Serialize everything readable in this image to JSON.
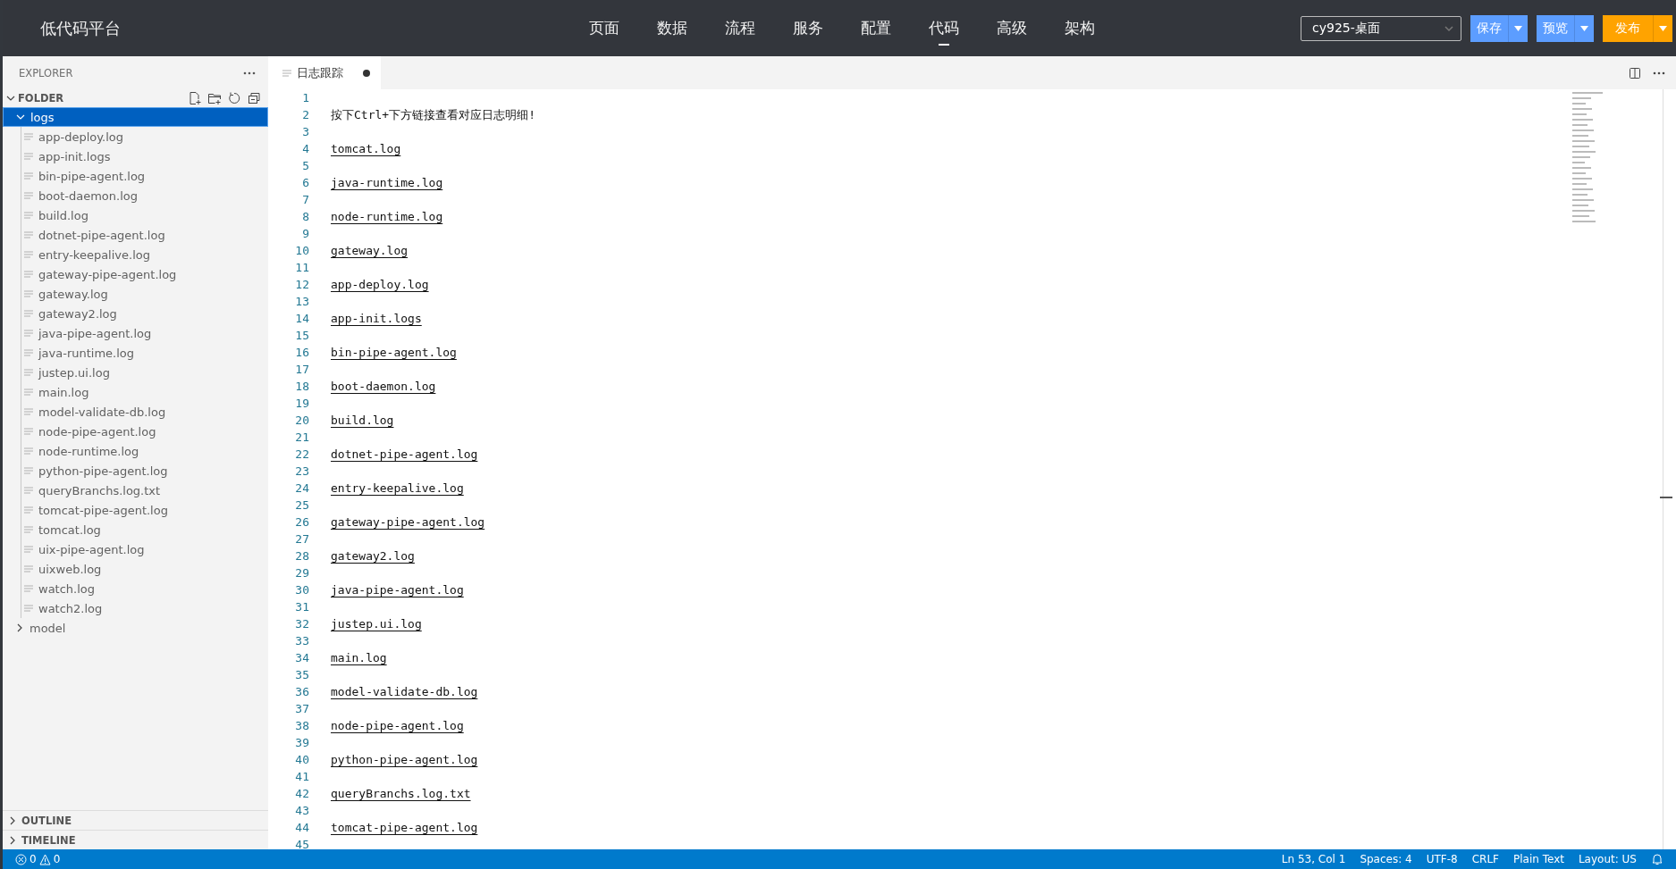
{
  "app": {
    "title": "低代码平台"
  },
  "nav": [
    {
      "label": "页面",
      "selected": false
    },
    {
      "label": "数据",
      "selected": false
    },
    {
      "label": "流程",
      "selected": false
    },
    {
      "label": "服务",
      "selected": false
    },
    {
      "label": "配置",
      "selected": false
    },
    {
      "label": "代码",
      "selected": true
    },
    {
      "label": "高级",
      "selected": false
    },
    {
      "label": "架构",
      "selected": false
    }
  ],
  "workspace_select": {
    "value": "cy925-桌面"
  },
  "actions": [
    {
      "label": "保存",
      "kind": "blue"
    },
    {
      "label": "预览",
      "kind": "blue"
    },
    {
      "label": "发布",
      "kind": "orange"
    }
  ],
  "sidebar": {
    "title": "EXPLORER",
    "section": "FOLDER",
    "tree": [
      {
        "label": "logs",
        "expanded": true,
        "selected": true,
        "children": [
          {
            "label": "app-deploy.log"
          },
          {
            "label": "app-init.logs"
          },
          {
            "label": "bin-pipe-agent.log"
          },
          {
            "label": "boot-daemon.log"
          },
          {
            "label": "build.log"
          },
          {
            "label": "dotnet-pipe-agent.log"
          },
          {
            "label": "entry-keepalive.log"
          },
          {
            "label": "gateway-pipe-agent.log"
          },
          {
            "label": "gateway.log"
          },
          {
            "label": "gateway2.log"
          },
          {
            "label": "java-pipe-agent.log"
          },
          {
            "label": "java-runtime.log"
          },
          {
            "label": "justep.ui.log"
          },
          {
            "label": "main.log"
          },
          {
            "label": "model-validate-db.log"
          },
          {
            "label": "node-pipe-agent.log"
          },
          {
            "label": "node-runtime.log"
          },
          {
            "label": "python-pipe-agent.log"
          },
          {
            "label": "queryBranchs.log.txt"
          },
          {
            "label": "tomcat-pipe-agent.log"
          },
          {
            "label": "tomcat.log"
          },
          {
            "label": "uix-pipe-agent.log"
          },
          {
            "label": "uixweb.log"
          },
          {
            "label": "watch.log"
          },
          {
            "label": "watch2.log"
          }
        ]
      },
      {
        "label": "model",
        "expanded": false,
        "selected": false
      }
    ],
    "panels": [
      {
        "label": "OUTLINE",
        "expanded": false
      },
      {
        "label": "TIMELINE",
        "expanded": false
      }
    ]
  },
  "tab": {
    "label": "日志跟踪",
    "dirty": true
  },
  "editor": {
    "lines": [
      {
        "number": "1",
        "kind": "blank"
      },
      {
        "number": "2",
        "kind": "text",
        "text": "按下Ctrl+下方链接查看对应日志明细!"
      },
      {
        "number": "3",
        "kind": "blank"
      },
      {
        "number": "4",
        "kind": "link",
        "text": "tomcat.log"
      },
      {
        "number": "5",
        "kind": "blank"
      },
      {
        "number": "6",
        "kind": "link",
        "text": "java-runtime.log"
      },
      {
        "number": "7",
        "kind": "blank"
      },
      {
        "number": "8",
        "kind": "link",
        "text": "node-runtime.log"
      },
      {
        "number": "9",
        "kind": "blank"
      },
      {
        "number": "10",
        "kind": "link",
        "text": "gateway.log"
      },
      {
        "number": "11",
        "kind": "blank"
      },
      {
        "number": "12",
        "kind": "link",
        "text": "app-deploy.log"
      },
      {
        "number": "13",
        "kind": "blank"
      },
      {
        "number": "14",
        "kind": "link",
        "text": "app-init.logs"
      },
      {
        "number": "15",
        "kind": "blank"
      },
      {
        "number": "16",
        "kind": "link",
        "text": "bin-pipe-agent.log"
      },
      {
        "number": "17",
        "kind": "blank"
      },
      {
        "number": "18",
        "kind": "link",
        "text": "boot-daemon.log"
      },
      {
        "number": "19",
        "kind": "blank"
      },
      {
        "number": "20",
        "kind": "link",
        "text": "build.log"
      },
      {
        "number": "21",
        "kind": "blank"
      },
      {
        "number": "22",
        "kind": "link",
        "text": "dotnet-pipe-agent.log"
      },
      {
        "number": "23",
        "kind": "blank"
      },
      {
        "number": "24",
        "kind": "link",
        "text": "entry-keepalive.log"
      },
      {
        "number": "25",
        "kind": "blank"
      },
      {
        "number": "26",
        "kind": "link",
        "text": "gateway-pipe-agent.log"
      },
      {
        "number": "27",
        "kind": "blank"
      },
      {
        "number": "28",
        "kind": "link",
        "text": "gateway2.log"
      },
      {
        "number": "29",
        "kind": "blank"
      },
      {
        "number": "30",
        "kind": "link",
        "text": "java-pipe-agent.log"
      },
      {
        "number": "31",
        "kind": "blank"
      },
      {
        "number": "32",
        "kind": "link",
        "text": "justep.ui.log"
      },
      {
        "number": "33",
        "kind": "blank"
      },
      {
        "number": "34",
        "kind": "link",
        "text": "main.log"
      },
      {
        "number": "35",
        "kind": "blank"
      },
      {
        "number": "36",
        "kind": "link",
        "text": "model-validate-db.log"
      },
      {
        "number": "37",
        "kind": "blank"
      },
      {
        "number": "38",
        "kind": "link",
        "text": "node-pipe-agent.log"
      },
      {
        "number": "39",
        "kind": "blank"
      },
      {
        "number": "40",
        "kind": "link",
        "text": "python-pipe-agent.log"
      },
      {
        "number": "41",
        "kind": "blank"
      },
      {
        "number": "42",
        "kind": "link",
        "text": "queryBranchs.log.txt"
      },
      {
        "number": "43",
        "kind": "blank"
      },
      {
        "number": "44",
        "kind": "link",
        "text": "tomcat-pipe-agent.log"
      },
      {
        "number": "45",
        "kind": "blank"
      }
    ]
  },
  "status_bar": {
    "errors": "0",
    "warnings": "0",
    "items": [
      "Ln 53, Col 1",
      "Spaces: 4",
      "UTF-8",
      "CRLF",
      "Plain Text",
      "Layout: US"
    ]
  }
}
